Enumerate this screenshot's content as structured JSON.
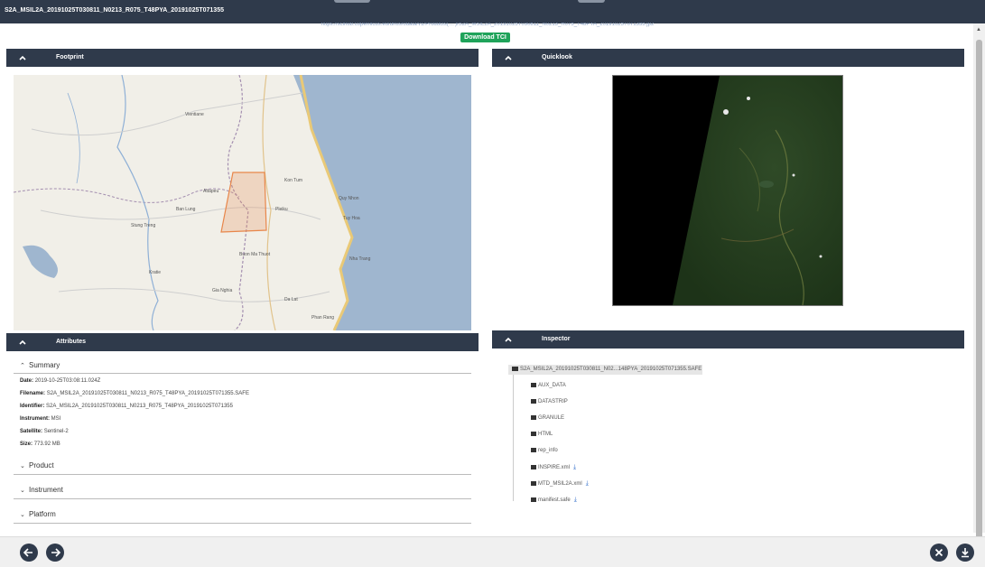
{
  "window": {
    "title": "S2A_MSIL2A_20191025T030811_N0213_R075_T48PYA_20191025T071355"
  },
  "product_url": "https://scihub.copernicus.eu/dhus/odata/v1/Products('...')/S2A_MSIL2A_20191025T030811_N0213_R075_T48PYA_20191025T071355.jp2",
  "download_tci_label": "Download TCI",
  "panels": {
    "footprint": "Footprint",
    "quicklook": "Quicklook",
    "attributes": "Attributes",
    "inspector": "Inspector"
  },
  "attributes": {
    "summary_title": "Summary",
    "rows": [
      {
        "key": "Date:",
        "value": "2019-10-25T03:08:11.024Z"
      },
      {
        "key": "Filename:",
        "value": "S2A_MSIL2A_20191025T030811_N0213_R075_T48PYA_20191025T071355.SAFE"
      },
      {
        "key": "Identifier:",
        "value": "S2A_MSIL2A_20191025T030811_N0213_R075_T48PYA_20191025T071355"
      },
      {
        "key": "Instrument:",
        "value": "MSI"
      },
      {
        "key": "Satellite:",
        "value": "Sentinel-2"
      },
      {
        "key": "Size:",
        "value": "773.92 MB"
      }
    ],
    "sections": [
      "Product",
      "Instrument",
      "Platform"
    ]
  },
  "inspector": {
    "root": "S2A_MSIL2A_20191025T030811_N02...148PYA_20191025T071355.SAFE",
    "items": [
      {
        "label": "AUX_DATA",
        "download": false
      },
      {
        "label": "DATASTRIP",
        "download": false
      },
      {
        "label": "GRANULE",
        "download": false
      },
      {
        "label": "HTML",
        "download": false
      },
      {
        "label": "rep_info",
        "download": false
      },
      {
        "label": "INSPIRE.xml",
        "download": true
      },
      {
        "label": "MTD_MSIL2A.xml",
        "download": true
      },
      {
        "label": "manifest.safe",
        "download": true
      }
    ]
  },
  "map_labels": [
    "Vientiane",
    "Attapeu",
    "Kon Tum",
    "Pleiku",
    "Quy Nhon",
    "Tuy Hoa",
    "Nha Trang",
    "Stung Treng",
    "Ban Lung",
    "Kratie",
    "Buon Ma Thuot",
    "Gia Nghia",
    "Da Lat",
    "Phan Rang"
  ],
  "icons": {
    "collapse": "chevron-up-icon",
    "expand": "chevron-down-icon",
    "prev": "arrow-left-icon",
    "next": "arrow-right-icon",
    "close": "close-icon",
    "download": "download-icon"
  },
  "colors": {
    "header": "#2f3a4b",
    "download_button": "#1fa35a",
    "footprint": "#e8864a"
  }
}
